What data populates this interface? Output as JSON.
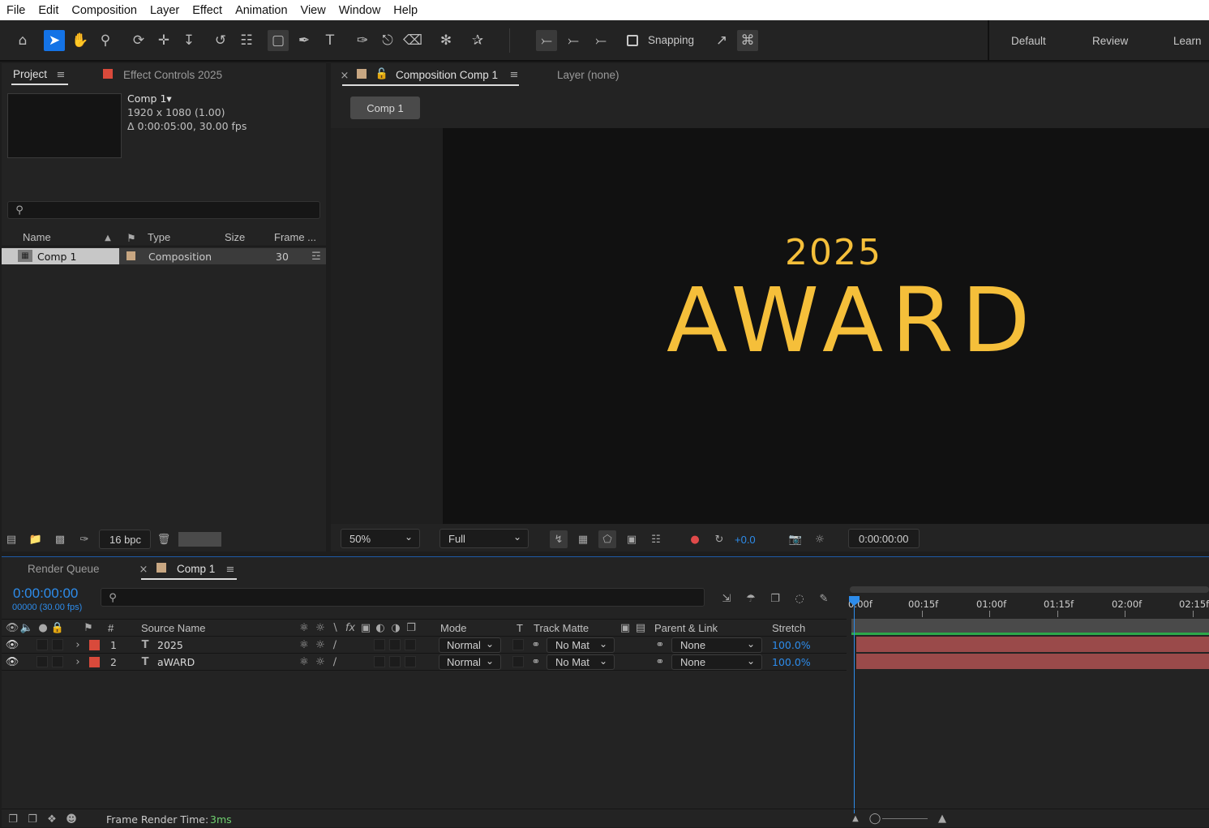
{
  "menu": [
    "File",
    "Edit",
    "Composition",
    "Layer",
    "Effect",
    "Animation",
    "View",
    "Window",
    "Help"
  ],
  "toolbar": {
    "snapping_label": "Snapping",
    "workspaces": [
      "Default",
      "Review",
      "Learn"
    ]
  },
  "project": {
    "tab_label": "Project",
    "effect_controls_label": "Effect Controls 2025",
    "comp_name": "Comp 1▾",
    "comp_dims": "1920 x 1080 (1.00)",
    "comp_duration": "Δ 0:00:05:00, 30.00 fps",
    "search_placeholder": "",
    "columns": [
      "Name",
      "Type",
      "Size",
      "Frame ..."
    ],
    "items": [
      {
        "name": "Comp 1",
        "type": "Composition",
        "size": "",
        "frame": "30"
      }
    ],
    "bpc_label": "16 bpc"
  },
  "comp_viewer": {
    "tab_label": "Composition Comp 1",
    "layer_tab_label": "Layer (none)",
    "breadcrumb": "Comp 1",
    "canvas_line1": "2025",
    "canvas_line2": "AWARD",
    "text_color": "#f5bf3a",
    "zoom": "50%",
    "resolution": "Full",
    "exposure": "+0.0",
    "timecode": "0:00:00:00"
  },
  "timeline": {
    "render_queue_label": "Render Queue",
    "tab_label": "Comp 1",
    "current_time": "0:00:00:00",
    "frame_info": "00000 (30.00 fps)",
    "columns": {
      "num": "#",
      "source_name": "Source Name",
      "mode": "Mode",
      "t": "T",
      "track_matte": "Track Matte",
      "parent": "Parent & Link",
      "stretch": "Stretch"
    },
    "ruler_labels": [
      "0:00f",
      "00:15f",
      "01:00f",
      "01:15f",
      "02:00f",
      "02:15f"
    ],
    "layers": [
      {
        "num": "1",
        "name": "2025",
        "mode": "Normal",
        "matte": "No Mat",
        "parent": "None",
        "stretch": "100.0%"
      },
      {
        "num": "2",
        "name": "aWARD",
        "mode": "Normal",
        "matte": "No Mat",
        "parent": "None",
        "stretch": "100.0%"
      }
    ],
    "layer_color": "#d94a3b",
    "bar_color": "#9a4a4a",
    "status_label": "Frame Render Time:",
    "status_value": "3ms"
  }
}
